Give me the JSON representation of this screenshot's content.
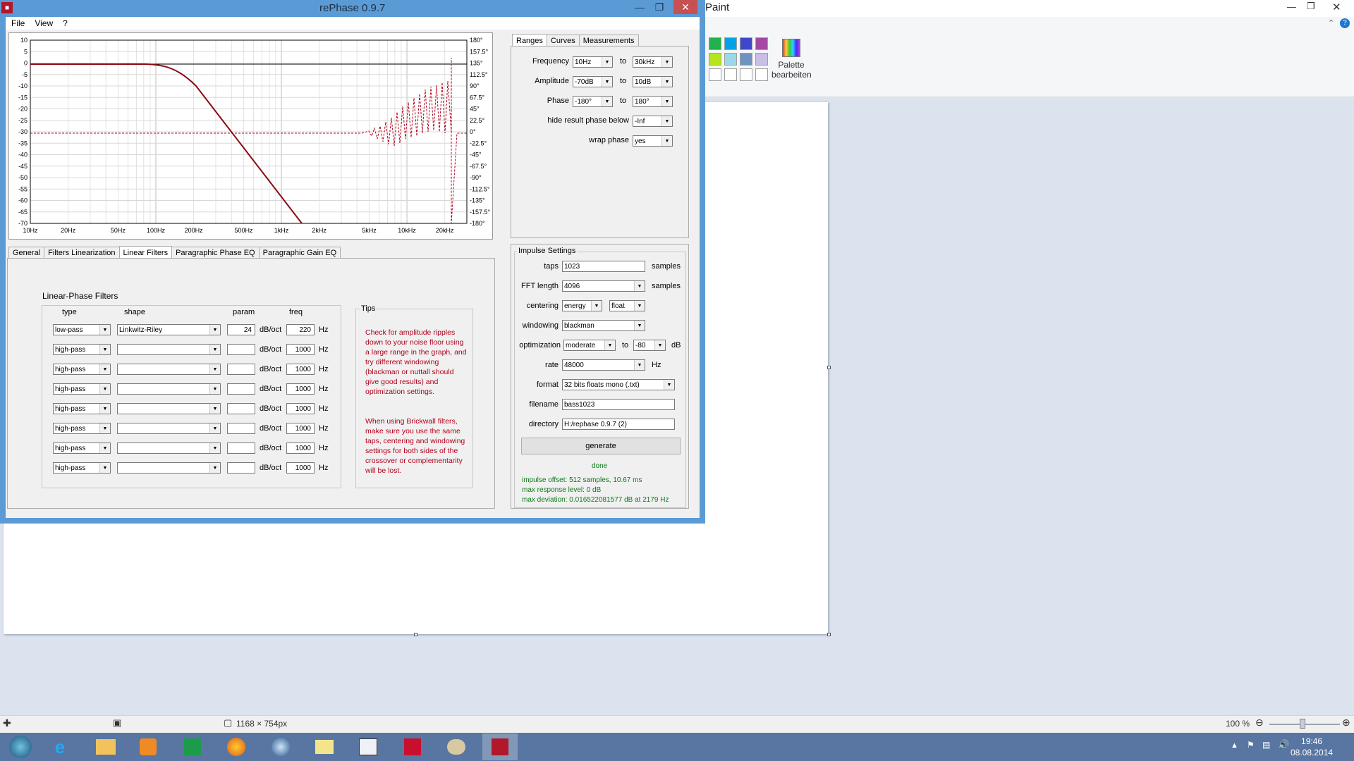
{
  "paint": {
    "title": "Paint",
    "palette_label": "Palette bearbeiten",
    "swatches_row1": [
      "#22b14c",
      "#00a2e8",
      "#3f48cc",
      "#a349a4"
    ],
    "swatches_row2": [
      "#b5e61d",
      "#99d9ea",
      "#7092be",
      "#c8bfe7"
    ],
    "swatches_row3": [
      "#ffffff",
      "#ffffff",
      "#ffffff",
      "#ffffff"
    ],
    "status_size": "1168 × 754px",
    "zoom": "100 %"
  },
  "rephase": {
    "title": "rePhase 0.9.7",
    "menu": [
      "File",
      "View",
      "?"
    ],
    "graph": {
      "y_ticks": [
        "10",
        "5",
        "0",
        "-5",
        "-10",
        "-15",
        "-20",
        "-25",
        "-30",
        "-35",
        "-40",
        "-45",
        "-50",
        "-55",
        "-60",
        "-65",
        "-70"
      ],
      "phase_ticks": [
        "180°",
        "157.5°",
        "135°",
        "112.5°",
        "90°",
        "67.5°",
        "45°",
        "22.5°",
        "0°",
        "-22.5°",
        "-45°",
        "-67.5°",
        "-90°",
        "-112.5°",
        "-135°",
        "-157.5°",
        "-180°"
      ],
      "x_ticks": [
        "10Hz",
        "20Hz",
        "50Hz",
        "100Hz",
        "200Hz",
        "500Hz",
        "1kHz",
        "2kHz",
        "5kHz",
        "10kHz",
        "20kHz"
      ]
    },
    "bottom_tabs": [
      "General",
      "Filters Linearization",
      "Linear Filters",
      "Paragraphic Phase EQ",
      "Paragraphic Gain EQ"
    ],
    "linear_filters": {
      "title": "Linear-Phase Filters",
      "col_type": "type",
      "col_shape": "shape",
      "col_param": "param",
      "col_freq": "freq",
      "unit_param": "dB/oct",
      "unit_freq": "Hz",
      "rows": [
        {
          "type": "low-pass",
          "shape": "Linkwitz-Riley",
          "param": "24",
          "freq": "220"
        },
        {
          "type": "high-pass",
          "shape": "",
          "param": "",
          "freq": "1000"
        },
        {
          "type": "high-pass",
          "shape": "",
          "param": "",
          "freq": "1000"
        },
        {
          "type": "high-pass",
          "shape": "",
          "param": "",
          "freq": "1000"
        },
        {
          "type": "high-pass",
          "shape": "",
          "param": "",
          "freq": "1000"
        },
        {
          "type": "high-pass",
          "shape": "",
          "param": "",
          "freq": "1000"
        },
        {
          "type": "high-pass",
          "shape": "",
          "param": "",
          "freq": "1000"
        },
        {
          "type": "high-pass",
          "shape": "",
          "param": "",
          "freq": "1000"
        }
      ]
    },
    "tips": {
      "title": "Tips",
      "p1": "Check for amplitude ripples down to your noise floor using a large range in the graph, and try different windowing (blackman or nuttall should give good results) and optimization settings.",
      "p2": "When using Brickwall filters, make sure you use the same taps, centering and windowing settings for both sides of the crossover or complementarity will be lost."
    },
    "right_tabs": [
      "Ranges",
      "Curves",
      "Measurements"
    ],
    "ranges": {
      "frequency_label": "Frequency",
      "frequency_from": "10Hz",
      "frequency_to": "30kHz",
      "amplitude_label": "Amplitude",
      "amplitude_from": "-70dB",
      "amplitude_to": "10dB",
      "phase_label": "Phase",
      "phase_from": "-180°",
      "phase_to": "180°",
      "to": "to",
      "hide_label": "hide result phase below",
      "hide_value": "-Inf",
      "wrap_label": "wrap phase",
      "wrap_value": "yes"
    },
    "impulse": {
      "title": "Impulse Settings",
      "taps_label": "taps",
      "taps_value": "1023",
      "samples": "samples",
      "fft_label": "FFT length",
      "fft_value": "4096",
      "centering_label": "centering",
      "centering_value": "energy",
      "centering_value2": "float",
      "windowing_label": "windowing",
      "windowing_value": "blackman",
      "optimization_label": "optimization",
      "optimization_value": "moderate",
      "optimization_to": "to",
      "optimization_db": "-80",
      "db": "dB",
      "rate_label": "rate",
      "rate_value": "48000",
      "hz": "Hz",
      "format_label": "format",
      "format_value": "32 bits floats mono (.txt)",
      "filename_label": "filename",
      "filename_value": "bass1023",
      "directory_label": "directory",
      "directory_value": "H:/rephase 0.9.7 (2)",
      "generate": "generate",
      "status": "done",
      "info1": "impulse offset: 512 samples, 10.67 ms",
      "info2": "max response level: 0 dB",
      "info3": "max deviation: 0.016522081577 dB at 2179 Hz"
    }
  },
  "taskbar": {
    "time": "19:46",
    "date": "08.08.2014"
  }
}
